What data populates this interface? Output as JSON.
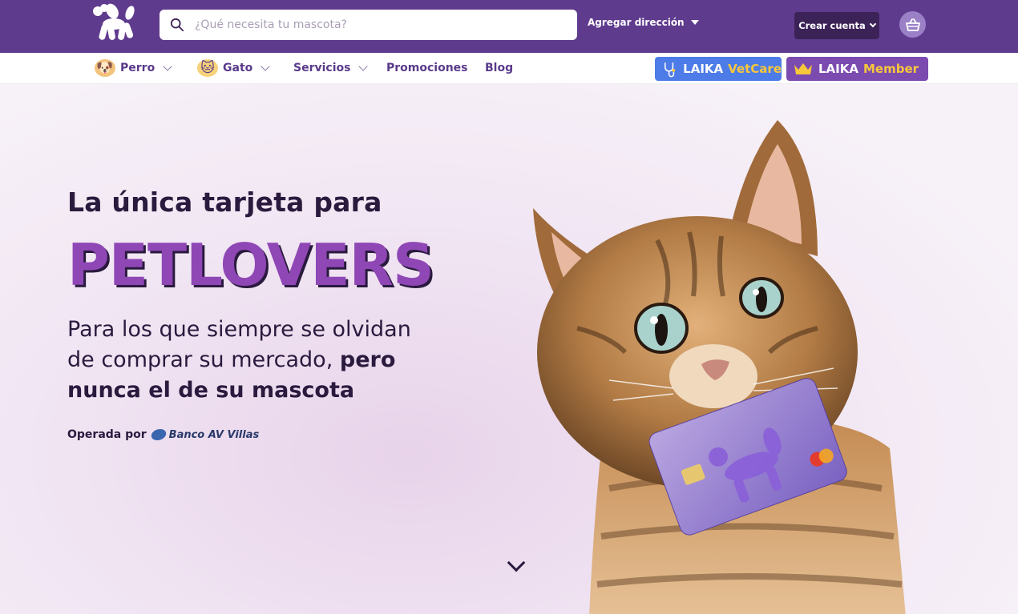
{
  "header": {
    "search_placeholder": "¿Qué necesita tu mascota?",
    "address_label": "Agregar dirección",
    "account_label": "Crear cuenta"
  },
  "nav": {
    "items": [
      {
        "label": "Perro",
        "icon": "dog-icon",
        "dropdown": true
      },
      {
        "label": "Gato",
        "icon": "cat-icon",
        "dropdown": true
      },
      {
        "label": "Servicios",
        "dropdown": true
      },
      {
        "label": "Promociones",
        "dropdown": false
      },
      {
        "label": "Blog",
        "dropdown": false
      }
    ],
    "vetcare": {
      "brand": "LAIKA",
      "accent": "VetCare"
    },
    "member": {
      "brand": "LAIKA",
      "accent": "Member"
    }
  },
  "hero": {
    "line1": "La única tarjeta para",
    "headline": "PETLOVERS",
    "sub_regular": "Para los que siempre se olvidan de comprar su mercado, ",
    "sub_bold": "pero nunca el de su mascota",
    "operated_by": "Operada por",
    "bank_name": "Banco AV Villas"
  },
  "colors": {
    "header_bg": "#5f3b8e",
    "accent_purple": "#8f47b5",
    "vetcare_blue": "#4d7be8",
    "member_purple": "#7b4bb0",
    "gold": "#f7c73c"
  }
}
